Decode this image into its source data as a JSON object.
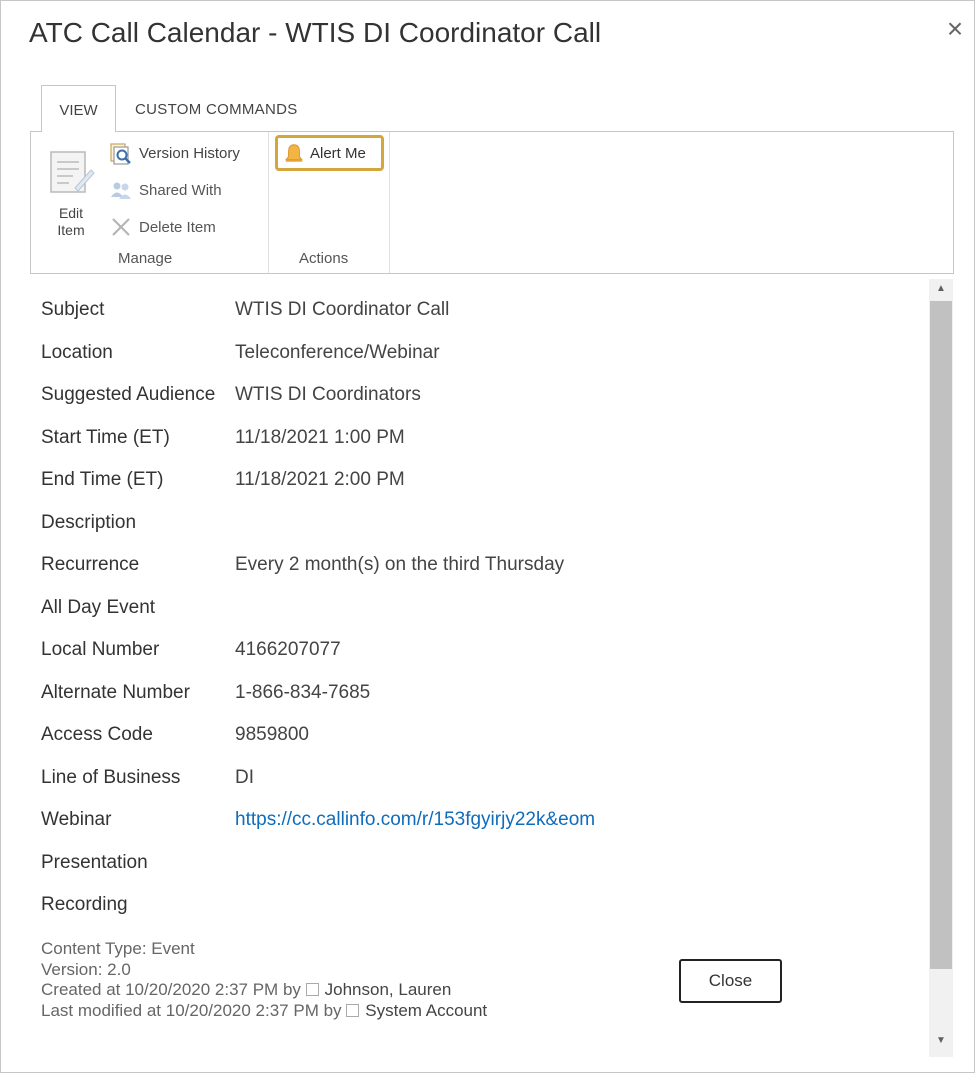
{
  "dialog": {
    "title": "ATC Call Calendar - WTIS DI Coordinator Call",
    "close_glyph": "×"
  },
  "ribbon": {
    "tabs": [
      {
        "label": "VIEW",
        "active": true
      },
      {
        "label": "CUSTOM COMMANDS",
        "active": false
      }
    ],
    "manage": {
      "edit_item_line1": "Edit",
      "edit_item_line2": "Item",
      "version_history": "Version History",
      "shared_with": "Shared With",
      "delete_item": "Delete Item",
      "group_label": "Manage"
    },
    "actions": {
      "alert_me": "Alert Me",
      "group_label": "Actions"
    }
  },
  "fields": [
    {
      "label": "Subject",
      "value": "WTIS DI Coordinator Call"
    },
    {
      "label": "Location",
      "value": "Teleconference/Webinar"
    },
    {
      "label": "Suggested Audience",
      "value": "WTIS DI Coordinators"
    },
    {
      "label": "Start Time (ET)",
      "value": "11/18/2021 1:00 PM"
    },
    {
      "label": "End Time (ET)",
      "value": "11/18/2021 2:00 PM"
    },
    {
      "label": "Description",
      "value": ""
    },
    {
      "label": "Recurrence",
      "value": "Every 2 month(s) on the third Thursday"
    },
    {
      "label": "All Day Event",
      "value": ""
    },
    {
      "label": "Local Number",
      "value": "4166207077"
    },
    {
      "label": "Alternate Number",
      "value": "1-866-834-7685"
    },
    {
      "label": "Access Code",
      "value": "9859800"
    },
    {
      "label": "Line of Business",
      "value": "DI"
    },
    {
      "label": "Webinar",
      "value": "https://cc.callinfo.com/r/153fgyirjy22k&eom"
    },
    {
      "label": "Presentation",
      "value": ""
    },
    {
      "label": "Recording",
      "value": ""
    }
  ],
  "meta": {
    "content_type": "Content Type: Event",
    "version": "Version: 2.0",
    "created_prefix": "Created at 10/20/2020 2:37 PM by",
    "created_by": "Johnson, Lauren",
    "modified_prefix": "Last modified at 10/20/2020 2:37 PM by",
    "modified_by": "System Account"
  },
  "buttons": {
    "close": "Close"
  },
  "colors": {
    "link": "#0f6cbd",
    "alert_highlight": "#d5a63d"
  }
}
